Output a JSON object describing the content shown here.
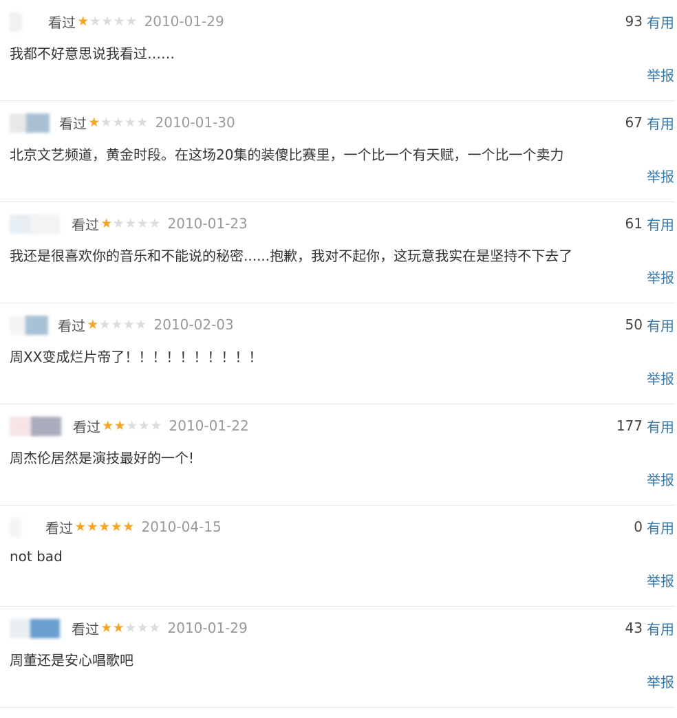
{
  "colors": {
    "star_on": "#f5a623",
    "star_off": "#dcdcdc",
    "link": "#3377aa",
    "date": "#999999"
  },
  "reviews": [
    {
      "status": "看过",
      "rating": 1,
      "date": "2010-01-29",
      "votes": "93",
      "useful": "有用",
      "content": "我都不好意思说我看过……",
      "report": "举报",
      "avatar": [
        "#f1f1f1",
        "#ffffff"
      ]
    },
    {
      "status": "看过",
      "rating": 1,
      "date": "2010-01-30",
      "votes": "67",
      "useful": "有用",
      "content": "北京文艺频道，黄金时段。在这场20集的装傻比赛里，一个比一个有天赋，一个比一个卖力",
      "report": "举报",
      "avatar": [
        "#e8e8e8",
        "#a9c0d3"
      ]
    },
    {
      "status": "看过",
      "rating": 1,
      "date": "2010-01-23",
      "votes": "61",
      "useful": "有用",
      "content": "我还是很喜欢你的音乐和不能说的秘密......抱歉，我对不起你，这玩意我实在是坚持不下去了",
      "report": "举报",
      "avatar": [
        "#e6eef4",
        "#f3f3f3"
      ]
    },
    {
      "status": "看过",
      "rating": 1,
      "date": "2010-02-03",
      "votes": "50",
      "useful": "有用",
      "content": "周XX变成烂片帝了！！！！！！！！！！",
      "report": "举报",
      "avatar": [
        "#f4f4f4",
        "#a8c1d6"
      ]
    },
    {
      "status": "看过",
      "rating": 2,
      "date": "2010-01-22",
      "votes": "177",
      "useful": "有用",
      "content": "周杰伦居然是演技最好的一个!",
      "report": "举报",
      "avatar": [
        "#f6e4e4",
        "#a9acbc"
      ]
    },
    {
      "status": "看过",
      "rating": 5,
      "date": "2010-04-15",
      "votes": "0",
      "useful": "有用",
      "content": "not bad",
      "report": "举报",
      "avatar": [
        "#f5f5f5",
        "#ffffff"
      ]
    },
    {
      "status": "看过",
      "rating": 2,
      "date": "2010-01-29",
      "votes": "43",
      "useful": "有用",
      "content": "周董还是安心唱歌吧",
      "report": "举报",
      "avatar": [
        "#e9eef2",
        "#6a9fcf"
      ]
    }
  ]
}
